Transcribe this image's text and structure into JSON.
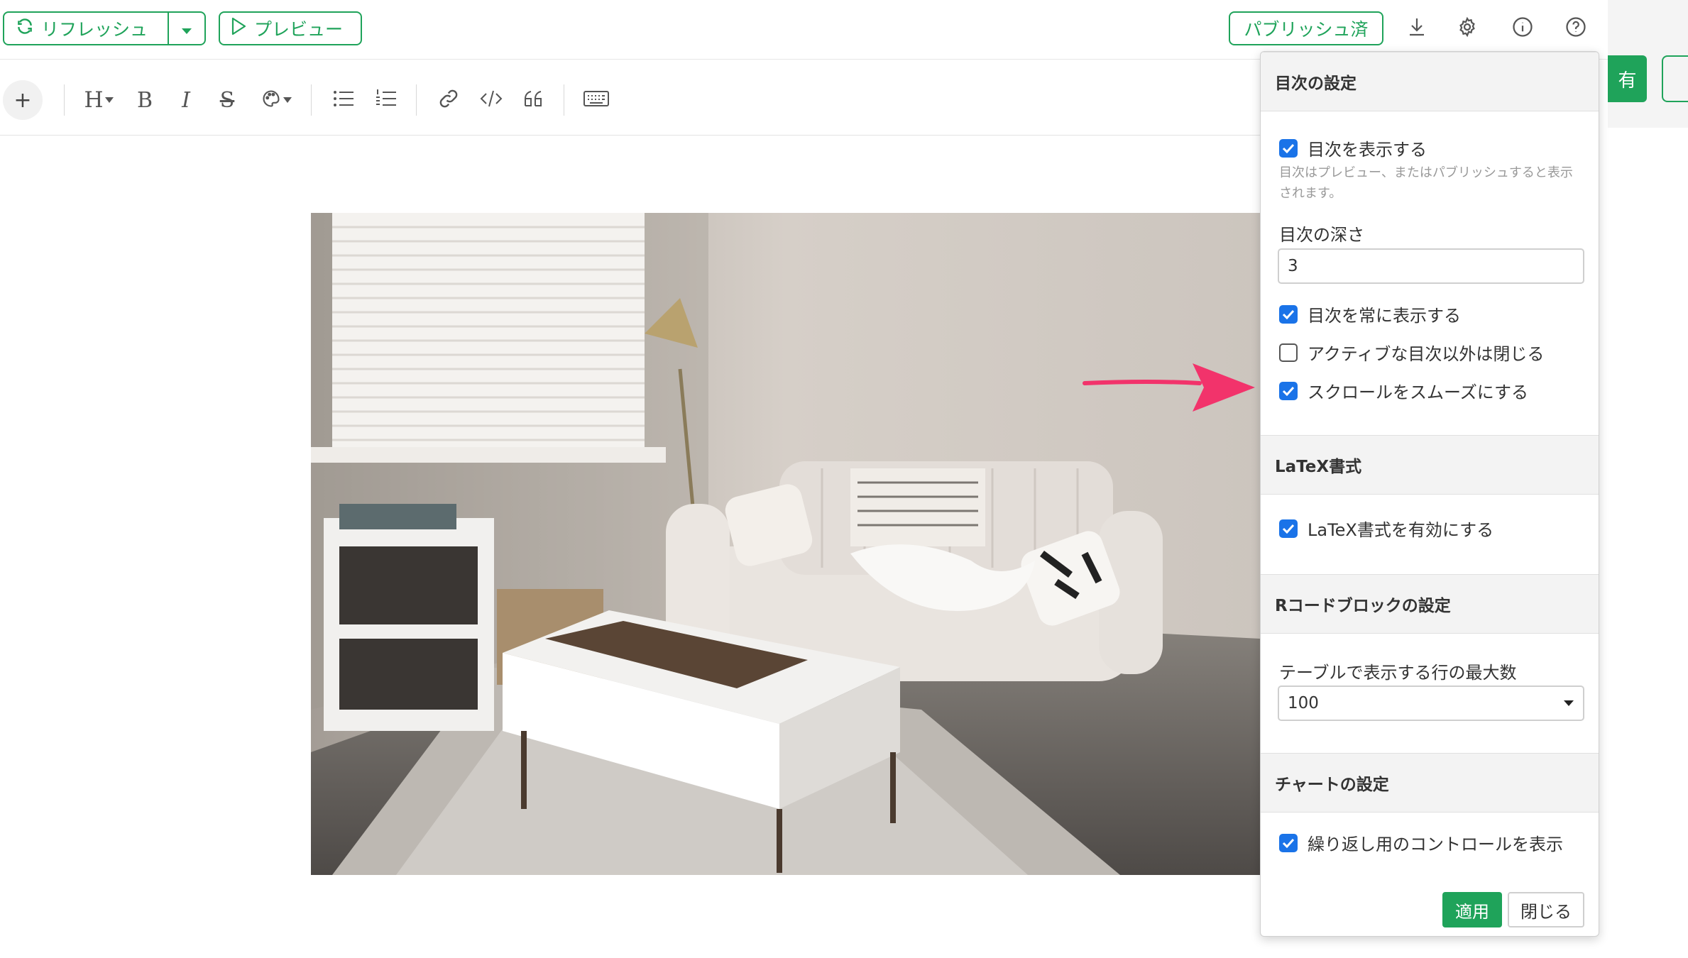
{
  "topbar": {
    "refresh_label": "リフレッシュ",
    "preview_label": "プレビュー",
    "publish_label": "パブリッシュ済",
    "icons": [
      "refresh-icon",
      "caret-down-icon",
      "play-icon",
      "download-icon",
      "gear-icon",
      "info-icon",
      "help-icon"
    ]
  },
  "toolbar": {
    "plus": "+",
    "heading": "H",
    "bold": "B",
    "italic": "I",
    "strike": "S"
  },
  "behind": {
    "share_label": "有"
  },
  "settings": {
    "toc": {
      "title": "目次の設定",
      "show_toc": {
        "label": "目次を表示する",
        "checked": true
      },
      "hint": "目次はプレビュー、またはパブリッシュすると表示されます。",
      "depth_label": "目次の深さ",
      "depth_value": "3",
      "always_show": {
        "label": "目次を常に表示する",
        "checked": true
      },
      "collapse_inactive": {
        "label": "アクティブな目次以外は閉じる",
        "checked": false
      },
      "smooth_scroll": {
        "label": "スクロールをスムーズにする",
        "checked": true
      }
    },
    "latex": {
      "title": "LaTeX書式",
      "enable": {
        "label": "LaTeX書式を有効にする",
        "checked": true
      }
    },
    "r_code": {
      "title": "Rコードブロックの設定",
      "max_rows_label": "テーブルで表示する行の最大数",
      "max_rows_value": "100"
    },
    "chart": {
      "title": "チャートの設定",
      "repeat_controls": {
        "label": "繰り返し用のコントロールを表示",
        "checked": true
      }
    },
    "apply_label": "適用",
    "close_label": "閉じる"
  },
  "colors": {
    "accent_green": "#1fa35a",
    "checkbox_blue": "#1a73e8",
    "arrow_pink": "#f2336b"
  }
}
